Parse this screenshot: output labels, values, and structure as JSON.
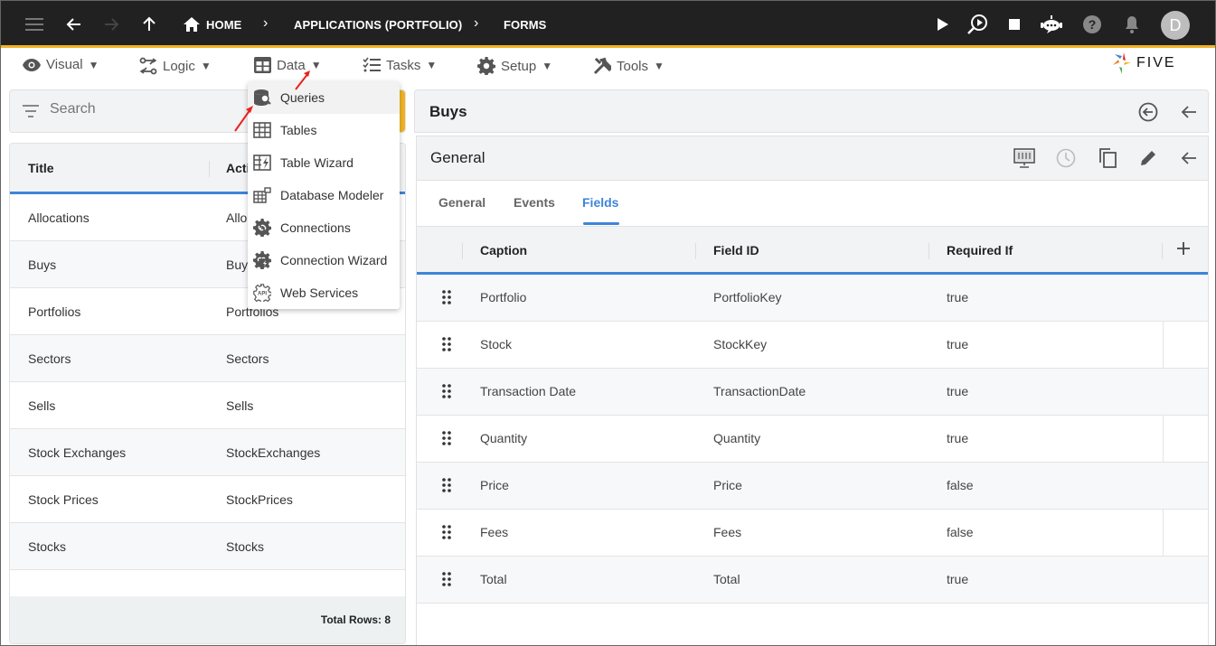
{
  "topbar": {
    "breadcrumbs": [
      "HOME",
      "APPLICATIONS (PORTFOLIO)",
      "FORMS"
    ],
    "avatar_initial": "D",
    "icons": [
      "menu-icon",
      "back-icon",
      "forward-icon",
      "up-icon",
      "home-icon",
      "play-icon",
      "inspect-run-icon",
      "stop-icon",
      "chat-bot-icon",
      "help-icon",
      "bell-icon"
    ]
  },
  "menubar": {
    "items": [
      {
        "label": "Visual",
        "icon": "eye-icon"
      },
      {
        "label": "Logic",
        "icon": "logic-flow-icon"
      },
      {
        "label": "Data",
        "icon": "grid-icon"
      },
      {
        "label": "Tasks",
        "icon": "checklist-icon"
      },
      {
        "label": "Setup",
        "icon": "gear-icon"
      },
      {
        "label": "Tools",
        "icon": "tools-icon"
      }
    ],
    "caret": "▼",
    "logo_text": "FIVE"
  },
  "data_menu": {
    "items": [
      {
        "label": "Queries",
        "icon": "database-search-icon",
        "highlighted": true
      },
      {
        "label": "Tables",
        "icon": "table-icon"
      },
      {
        "label": "Table Wizard",
        "icon": "table-wizard-icon"
      },
      {
        "label": "Database Modeler",
        "icon": "database-modeler-icon"
      },
      {
        "label": "Connections",
        "icon": "connections-icon"
      },
      {
        "label": "Connection Wizard",
        "icon": "connection-wizard-icon"
      },
      {
        "label": "Web Services",
        "icon": "api-gear-icon"
      }
    ]
  },
  "left": {
    "search_placeholder": "Search",
    "columns": [
      "Title",
      "Action ID"
    ],
    "rows": [
      [
        "Allocations",
        "Allocations"
      ],
      [
        "Buys",
        "Buys"
      ],
      [
        "Portfolios",
        "Portfolios"
      ],
      [
        "Sectors",
        "Sectors"
      ],
      [
        "Sells",
        "Sells"
      ],
      [
        "Stock Exchanges",
        "StockExchanges"
      ],
      [
        "Stock Prices",
        "StockPrices"
      ],
      [
        "Stocks",
        "Stocks"
      ]
    ],
    "footer": "Total Rows: 8"
  },
  "right": {
    "record_title": "Buys",
    "section_title": "General",
    "tabs": [
      "General",
      "Events",
      "Fields"
    ],
    "active_tab": "Fields",
    "columns": [
      "Caption",
      "Field ID",
      "Required If"
    ],
    "rows": [
      [
        "Portfolio",
        "PortfolioKey",
        "true"
      ],
      [
        "Stock",
        "StockKey",
        "true"
      ],
      [
        "Transaction Date",
        "TransactionDate",
        "true"
      ],
      [
        "Quantity",
        "Quantity",
        "true"
      ],
      [
        "Price",
        "Price",
        "false"
      ],
      [
        "Fees",
        "Fees",
        "false"
      ],
      [
        "Total",
        "Total",
        "true"
      ]
    ]
  },
  "colors": {
    "topbar": "#212121",
    "accent_yellow": "#f0b323",
    "accent_blue": "#3d85d8",
    "annotation_red": "#e8231c"
  }
}
